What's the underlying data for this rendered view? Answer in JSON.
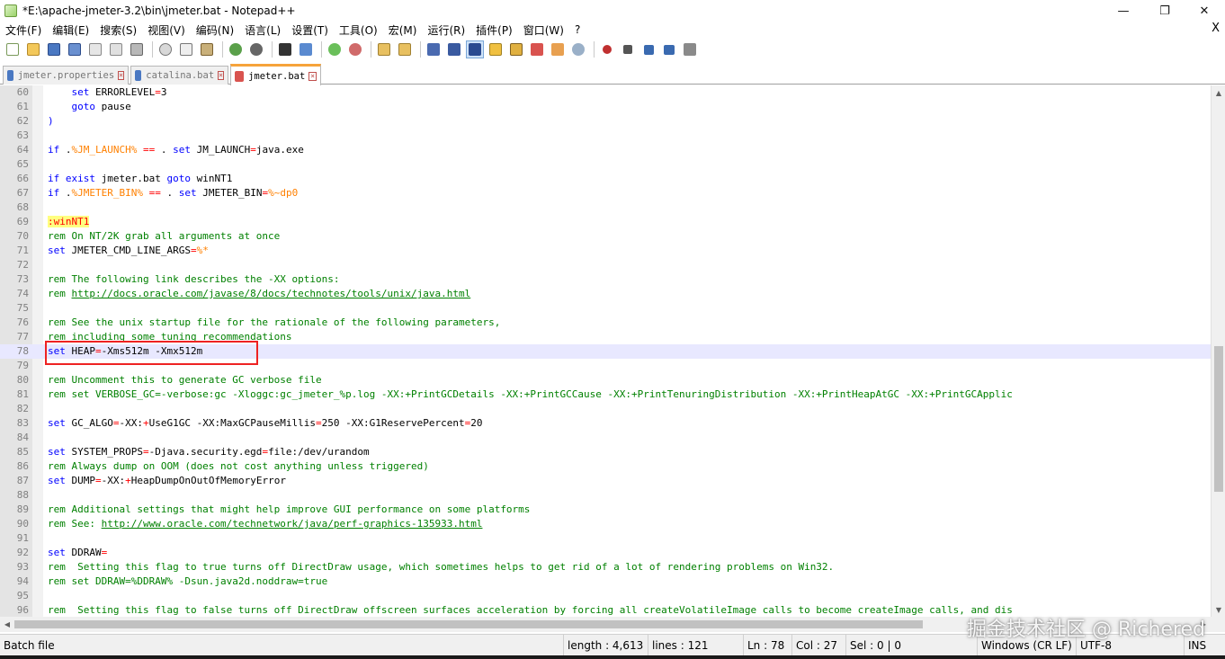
{
  "window": {
    "title": "*E:\\apache-jmeter-3.2\\bin\\jmeter.bat - Notepad++",
    "minimize": "—",
    "restore": "❐",
    "close": "✕"
  },
  "menu": {
    "items": [
      "文件(F)",
      "编辑(E)",
      "搜索(S)",
      "视图(V)",
      "编码(N)",
      "语言(L)",
      "设置(T)",
      "工具(O)",
      "宏(M)",
      "运行(R)",
      "插件(P)",
      "窗口(W)",
      "?"
    ],
    "close": "X"
  },
  "tabs": [
    {
      "label": "jmeter.properties",
      "active": false
    },
    {
      "label": "catalina.bat",
      "active": false
    },
    {
      "label": "jmeter.bat",
      "active": true
    }
  ],
  "editor": {
    "lines": [
      {
        "n": "60",
        "html": "    <span class=\"kw\">set</span> ERRORLEVEL<span class=\"op\">=</span>3"
      },
      {
        "n": "61",
        "html": "    <span class=\"kw\">goto</span> pause"
      },
      {
        "n": "62",
        "html": "<span class=\"kw\">)</span>"
      },
      {
        "n": "63",
        "html": ""
      },
      {
        "n": "64",
        "html": "<span class=\"kw\">if</span> .<span class=\"var\">%JM_LAUNCH%</span> <span class=\"op\">==</span> . <span class=\"kw\">set</span> JM_LAUNCH<span class=\"op\">=</span>java.exe"
      },
      {
        "n": "65",
        "html": ""
      },
      {
        "n": "66",
        "html": "<span class=\"kw\">if exist</span> jmeter.bat <span class=\"kw\">goto</span> winNT1"
      },
      {
        "n": "67",
        "html": "<span class=\"kw\">if</span> .<span class=\"var\">%JMETER_BIN%</span> <span class=\"op\">==</span> . <span class=\"kw\">set</span> JMETER_BIN<span class=\"op\">=</span><span class=\"var\">%~dp0</span>"
      },
      {
        "n": "68",
        "html": ""
      },
      {
        "n": "69",
        "html": "<span class=\"lbl\">:winNT1</span>"
      },
      {
        "n": "70",
        "html": "<span class=\"cm\">rem On NT/2K grab all arguments at once</span>"
      },
      {
        "n": "71",
        "html": "<span class=\"kw\">set</span> JMETER_CMD_LINE_ARGS<span class=\"op\">=</span><span class=\"var\">%*</span>"
      },
      {
        "n": "72",
        "html": ""
      },
      {
        "n": "73",
        "html": "<span class=\"cm\">rem The following link describes the -XX options:</span>"
      },
      {
        "n": "74",
        "html": "<span class=\"cm\">rem </span><span class=\"lnk\">http://docs.oracle.com/javase/8/docs/technotes/tools/unix/java.html</span>"
      },
      {
        "n": "75",
        "html": ""
      },
      {
        "n": "76",
        "html": "<span class=\"cm\">rem See the unix startup file for the rationale of the following parameters,</span>"
      },
      {
        "n": "77",
        "html": "<span class=\"cm\">rem including some tuning recommendations</span>"
      },
      {
        "n": "78",
        "html": "<span class=\"kw\">set</span> HEAP<span class=\"op\">=</span>-Xms512m -Xmx512m",
        "current": true
      },
      {
        "n": "79",
        "html": ""
      },
      {
        "n": "80",
        "html": "<span class=\"cm\">rem Uncomment this to generate GC verbose file</span>"
      },
      {
        "n": "81",
        "html": "<span class=\"cm\">rem set VERBOSE_GC=-verbose:gc -Xloggc:gc_jmeter_%p.log -XX:+PrintGCDetails -XX:+PrintGCCause -XX:+PrintTenuringDistribution -XX:+PrintHeapAtGC -XX:+PrintGCApplic</span>"
      },
      {
        "n": "82",
        "html": ""
      },
      {
        "n": "83",
        "html": "<span class=\"kw\">set</span> GC_ALGO<span class=\"op\">=</span>-XX:<span class=\"op\">+</span>UseG1GC -XX:MaxGCPauseMillis<span class=\"op\">=</span>250 -XX:G1ReservePercent<span class=\"op\">=</span>20"
      },
      {
        "n": "84",
        "html": ""
      },
      {
        "n": "85",
        "html": "<span class=\"kw\">set</span> SYSTEM_PROPS<span class=\"op\">=</span>-Djava.security.egd<span class=\"op\">=</span>file:/dev/urandom"
      },
      {
        "n": "86",
        "html": "<span class=\"cm\">rem Always dump on OOM (does not cost anything unless triggered)</span>"
      },
      {
        "n": "87",
        "html": "<span class=\"kw\">set</span> DUMP<span class=\"op\">=</span>-XX:<span class=\"op\">+</span>HeapDumpOnOutOfMemoryError"
      },
      {
        "n": "88",
        "html": ""
      },
      {
        "n": "89",
        "html": "<span class=\"cm\">rem Additional settings that might help improve GUI performance on some platforms</span>"
      },
      {
        "n": "90",
        "html": "<span class=\"cm\">rem See: </span><span class=\"lnk\">http://www.oracle.com/technetwork/java/perf-graphics-135933.html</span>"
      },
      {
        "n": "91",
        "html": ""
      },
      {
        "n": "92",
        "html": "<span class=\"kw\">set</span> DDRAW<span class=\"op\">=</span>"
      },
      {
        "n": "93",
        "html": "<span class=\"cm\">rem  Setting this flag to true turns off DirectDraw usage, which sometimes helps to get rid of a lot of rendering problems on Win32.</span>"
      },
      {
        "n": "94",
        "html": "<span class=\"cm\">rem set DDRAW=%DDRAW% -Dsun.java2d.noddraw=true</span>"
      },
      {
        "n": "95",
        "html": ""
      },
      {
        "n": "96",
        "html": "<span class=\"cm\">rem  Setting this flag to false turns off DirectDraw offscreen surfaces acceleration by forcing all createVolatileImage calls to become createImage calls, and dis</span>"
      }
    ]
  },
  "status": {
    "filetype": "Batch file",
    "length": "length : 4,613",
    "lines": "lines : 121",
    "ln": "Ln : 78",
    "col": "Col : 27",
    "sel": "Sel : 0 | 0",
    "eol": "Windows (CR LF)",
    "encoding": "UTF-8",
    "mode": "INS"
  },
  "watermark": "掘金技术社区 @ Richered",
  "colors": {
    "keyword": "#0000ff",
    "variable": "#ff8000",
    "operator": "#ff0000",
    "comment": "#008000",
    "current_line": "#e8e8ff",
    "active_tab_accent": "#f6a33a",
    "highlight_box": "#ee2222"
  }
}
